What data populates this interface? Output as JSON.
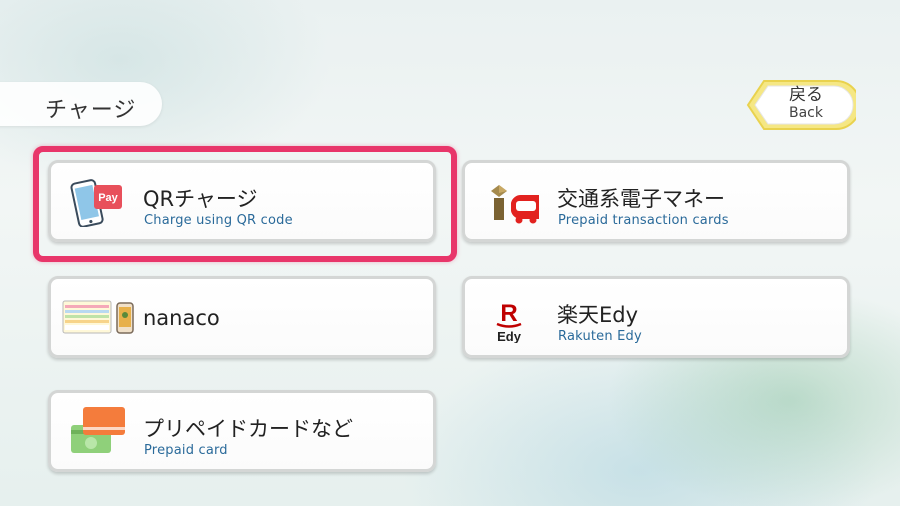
{
  "header": {
    "title": "チャージ"
  },
  "back_button": {
    "label_jp": "戻る",
    "label_en": "Back"
  },
  "cards": [
    {
      "id": "qr",
      "title": "QRチャージ",
      "subtitle": "Charge using QR code",
      "icon": "smartphone-pay-icon",
      "selected": true
    },
    {
      "id": "transit",
      "title": "交通系電子マネー",
      "subtitle": "Prepaid transaction cards",
      "icon": "ic-card-icon",
      "selected": false
    },
    {
      "id": "nanaco",
      "title": "nanaco",
      "subtitle": "",
      "icon": "nanaco-card-icon",
      "selected": false
    },
    {
      "id": "edy",
      "title": "楽天Edy",
      "subtitle": "Rakuten Edy",
      "icon": "rakuten-edy-icon",
      "selected": false
    },
    {
      "id": "prepaid",
      "title": "プリペイドカードなど",
      "subtitle": "Prepaid card",
      "icon": "prepaid-cards-icon",
      "selected": false
    }
  ],
  "icon_text": {
    "pay_badge": "Pay",
    "edy_letter": "R",
    "edy_word": "Edy"
  },
  "colors": {
    "highlight": "#e8366a",
    "subtitle": "#2a6a9a",
    "back_border": "#f3e27a"
  }
}
